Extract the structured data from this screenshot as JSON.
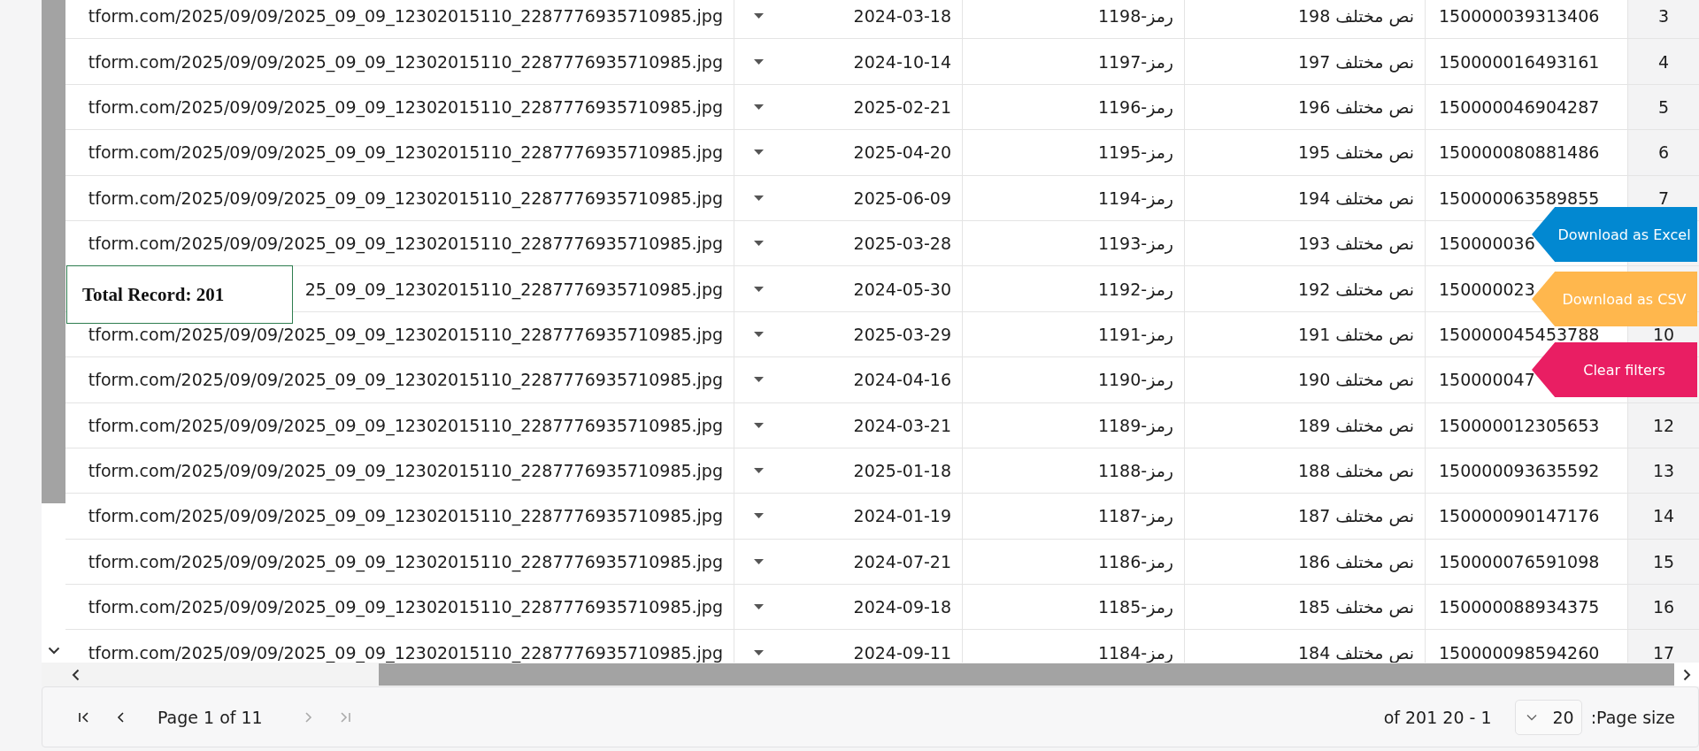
{
  "grid": {
    "rows": [
      {
        "url": "tform.com/2025/09/09/2025_09_09_12302015110_2287776935710985.jpg",
        "date": "2024-03-18",
        "code": "رمز-1198",
        "text": "نص مختلف 198",
        "id": "150000039313406",
        "row_number": "3"
      },
      {
        "url": "tform.com/2025/09/09/2025_09_09_12302015110_2287776935710985.jpg",
        "date": "2024-10-14",
        "code": "رمز-1197",
        "text": "نص مختلف 197",
        "id": "150000016493161",
        "row_number": "4"
      },
      {
        "url": "tform.com/2025/09/09/2025_09_09_12302015110_2287776935710985.jpg",
        "date": "2025-02-21",
        "code": "رمز-1196",
        "text": "نص مختلف 196",
        "id": "150000046904287",
        "row_number": "5"
      },
      {
        "url": "tform.com/2025/09/09/2025_09_09_12302015110_2287776935710985.jpg",
        "date": "2025-04-20",
        "code": "رمز-1195",
        "text": "نص مختلف 195",
        "id": "150000080881486",
        "row_number": "6"
      },
      {
        "url": "tform.com/2025/09/09/2025_09_09_12302015110_2287776935710985.jpg",
        "date": "2025-06-09",
        "code": "رمز-1194",
        "text": "نص مختلف 194",
        "id": "150000063589855",
        "row_number": "7"
      },
      {
        "url": "tform.com/2025/09/09/2025_09_09_12302015110_2287776935710985.jpg",
        "date": "2025-03-28",
        "code": "رمز-1193",
        "text": "نص مختلف 193",
        "id": "150000036"
      },
      {
        "url": "25_09_09_12302015110_2287776935710985.jpg",
        "date": "2024-05-30",
        "code": "رمز-1192",
        "text": "نص مختلف 192",
        "id": "150000023"
      },
      {
        "url": "tform.com/2025/09/09/2025_09_09_12302015110_2287776935710985.jpg",
        "date": "2025-03-29",
        "code": "رمز-1191",
        "text": "نص مختلف 191",
        "id": "150000045453788",
        "row_number": "10"
      },
      {
        "url": "tform.com/2025/09/09/2025_09_09_12302015110_2287776935710985.jpg",
        "date": "2024-04-16",
        "code": "رمز-1190",
        "text": "نص مختلف 190",
        "id": "150000047"
      },
      {
        "url": "tform.com/2025/09/09/2025_09_09_12302015110_2287776935710985.jpg",
        "date": "2024-03-21",
        "code": "رمز-1189",
        "text": "نص مختلف 189",
        "id": "150000012305653",
        "row_number": "12"
      },
      {
        "url": "tform.com/2025/09/09/2025_09_09_12302015110_2287776935710985.jpg",
        "date": "2025-01-18",
        "code": "رمز-1188",
        "text": "نص مختلف 188",
        "id": "150000093635592",
        "row_number": "13"
      },
      {
        "url": "tform.com/2025/09/09/2025_09_09_12302015110_2287776935710985.jpg",
        "date": "2024-01-19",
        "code": "رمز-1187",
        "text": "نص مختلف 187",
        "id": "150000090147176",
        "row_number": "14"
      },
      {
        "url": "tform.com/2025/09/09/2025_09_09_12302015110_2287776935710985.jpg",
        "date": "2024-07-21",
        "code": "رمز-1186",
        "text": "نص مختلف 186",
        "id": "150000076591098",
        "row_number": "15"
      },
      {
        "url": "tform.com/2025/09/09/2025_09_09_12302015110_2287776935710985.jpg",
        "date": "2024-09-18",
        "code": "رمز-1185",
        "text": "نص مختلف 185",
        "id": "150000088934375",
        "row_number": "16"
      },
      {
        "url": "tform.com/2025/09/09/2025_09_09_12302015110_2287776935710985.jpg",
        "date": "2024-09-11",
        "code": "رمز-1184",
        "text": "نص مختلف 184",
        "id": "150000098594260",
        "row_number": "17"
      }
    ]
  },
  "total_record": "Total Record: 201",
  "actions": [
    {
      "label": "Download as Excel",
      "color": "#0288d1"
    },
    {
      "label": "Download as CSV",
      "color": "#ffb74d"
    },
    {
      "label": "Clear filters",
      "color": "#e91e63"
    }
  ],
  "pagination": {
    "nav_buttons": [
      {
        "kind": "first",
        "disabled": false
      },
      {
        "kind": "previous",
        "disabled": false
      },
      {
        "kind": "next",
        "disabled": true
      },
      {
        "kind": "last",
        "disabled": true
      }
    ],
    "page_label": "Page 1 of 11",
    "range": "1 - 20 of 201",
    "page_size_label": "Page size:",
    "page_size": "20"
  }
}
